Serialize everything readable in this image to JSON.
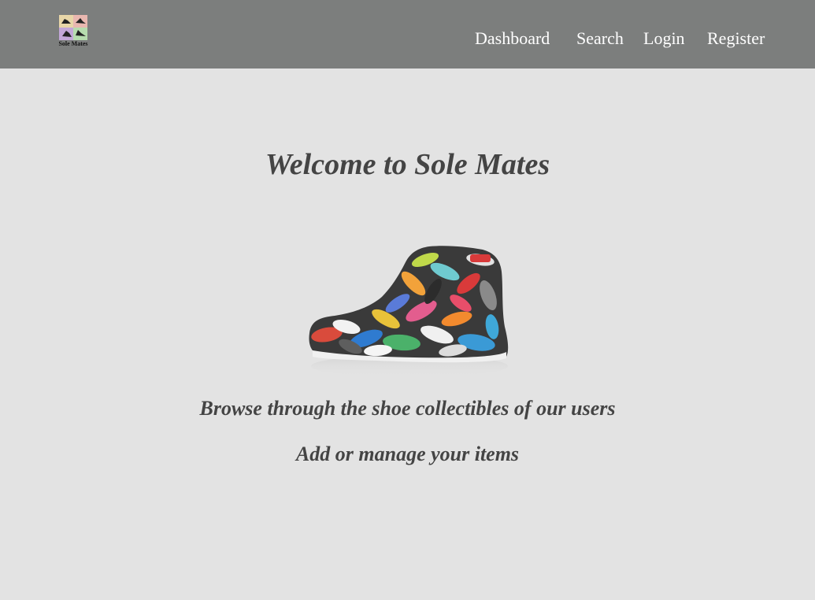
{
  "header": {
    "logo_text": "Sole Mates",
    "nav": {
      "dashboard": "Dashboard",
      "search": "Search",
      "login": "Login",
      "register": "Register"
    }
  },
  "main": {
    "title": "Welcome to Sole Mates",
    "hero_image": "sneaker-collage",
    "lines": [
      "Browse through the shoe collectibles of our users",
      "Add or manage your items"
    ]
  },
  "colors": {
    "navbar": "#7c7e7d",
    "background": "#e3e3e3",
    "text": "#444444",
    "nav_text": "#ffffff"
  }
}
